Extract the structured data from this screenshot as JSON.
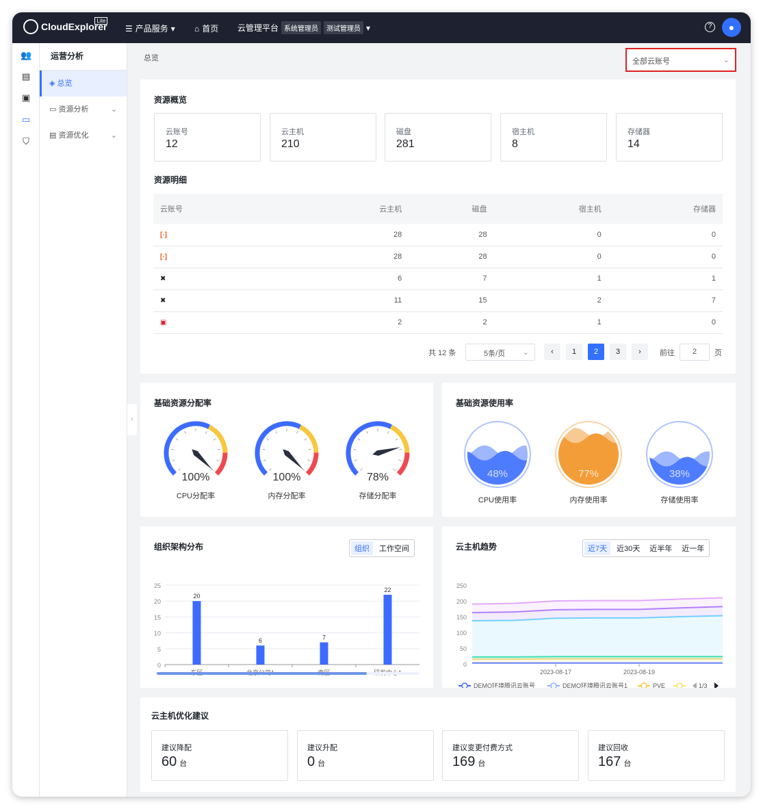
{
  "header": {
    "logo": "CloudExplorer",
    "logo_badge": "Lite",
    "products": "产品服务",
    "home": "首页",
    "platform": "云管理平台",
    "role1": "系统管理员",
    "role2": "测试管理员"
  },
  "sidebar": {
    "title": "运营分析",
    "items": [
      {
        "label": "总览"
      },
      {
        "label": "资源分析"
      },
      {
        "label": "资源优化"
      }
    ]
  },
  "breadcrumb": "总览",
  "account_select": "全部云账号",
  "overview": {
    "title": "资源概览",
    "stats": [
      {
        "label": "云账号",
        "value": "12"
      },
      {
        "label": "云主机",
        "value": "210"
      },
      {
        "label": "磁盘",
        "value": "281"
      },
      {
        "label": "宿主机",
        "value": "8"
      },
      {
        "label": "存储器",
        "value": "14"
      }
    ]
  },
  "detail": {
    "title": "资源明细",
    "columns": [
      "云账号",
      "云主机",
      "磁盘",
      "宿主机",
      "存储器"
    ],
    "rows": [
      [
        "",
        "28",
        "28",
        "0",
        "0"
      ],
      [
        "",
        "28",
        "28",
        "0",
        "0"
      ],
      [
        "",
        "6",
        "7",
        "1",
        "1"
      ],
      [
        "",
        "11",
        "15",
        "2",
        "7"
      ],
      [
        "",
        "2",
        "2",
        "1",
        "0"
      ]
    ],
    "total": "共 12 条",
    "page_size": "5条/页",
    "pages": [
      "1",
      "2",
      "3"
    ],
    "current_page": 2,
    "goto_label": "前往",
    "goto_value": "2",
    "page_unit": "页"
  },
  "allocation": {
    "title": "基础资源分配率",
    "gauges": [
      {
        "label": "CPU分配率",
        "value": 100,
        "text": "100%"
      },
      {
        "label": "内存分配率",
        "value": 100,
        "text": "100%"
      },
      {
        "label": "存储分配率",
        "value": 78,
        "text": "78%"
      }
    ]
  },
  "usage": {
    "title": "基础资源使用率",
    "items": [
      {
        "label": "CPU使用率",
        "value": 48,
        "text": "48%",
        "color": "#4e7cff"
      },
      {
        "label": "内存使用率",
        "value": 77,
        "text": "77%",
        "color": "#f29d38"
      },
      {
        "label": "存储使用率",
        "value": 38,
        "text": "38%",
        "color": "#4e7cff"
      }
    ]
  },
  "chart_data": [
    {
      "type": "bar",
      "title": "组织架构分布",
      "tabs": [
        "组织",
        "工作空间"
      ],
      "categories": [
        "东区",
        "北京公司1",
        "南区",
        "研发中心1"
      ],
      "values": [
        20,
        6,
        7,
        22
      ],
      "ylim": [
        0,
        25
      ],
      "yticks": [
        "0",
        "5",
        "10",
        "15",
        "20",
        "25"
      ]
    },
    {
      "type": "area",
      "title": "云主机趋势",
      "tabs": [
        "近7天",
        "近30天",
        "近半年",
        "近一年"
      ],
      "x": [
        "2023-08-15",
        "2023-08-16",
        "2023-08-17",
        "2023-08-18",
        "2023-08-19",
        "2023-08-20",
        "2023-08-21"
      ],
      "xticks": [
        "2023-08-17",
        "2023-08-19"
      ],
      "ylim": [
        0,
        250
      ],
      "yticks": [
        "0",
        "50",
        "100",
        "150",
        "200",
        "250"
      ],
      "series": [
        {
          "name": "DEMO环境腾讯云账号",
          "values": [
            3,
            3,
            3,
            3,
            3,
            3,
            3
          ],
          "color": "#5b7bff"
        },
        {
          "name": "DEMO环境腾讯云账号1",
          "values": [
            15,
            15,
            16,
            16,
            16,
            16,
            16
          ],
          "color": "#f5d77a"
        },
        {
          "name": "PVE",
          "values": [
            22,
            22,
            23,
            23,
            23,
            23,
            23
          ],
          "color": "#3de0a8"
        },
        {
          "name": "",
          "values": [
            137,
            138,
            145,
            146,
            146,
            150,
            153
          ],
          "color": "#6fd6ff"
        },
        {
          "name": "",
          "values": [
            163,
            165,
            172,
            173,
            173,
            178,
            182
          ],
          "color": "#b07cff"
        },
        {
          "name": "",
          "values": [
            190,
            192,
            200,
            201,
            201,
            206,
            210
          ],
          "color": "#e2a8ff"
        }
      ],
      "legend": [
        "DEMO环境腾讯云账号",
        "DEMO环境腾讯云账号1",
        "PVE",
        ""
      ],
      "legend_page": "1/3"
    }
  ],
  "optimize": {
    "title": "云主机优化建议",
    "items": [
      {
        "label": "建议降配",
        "value": "60",
        "unit": "台"
      },
      {
        "label": "建议升配",
        "value": "0",
        "unit": "台"
      },
      {
        "label": "建议变更付费方式",
        "value": "169",
        "unit": "台"
      },
      {
        "label": "建议回收",
        "value": "167",
        "unit": "台"
      }
    ]
  }
}
